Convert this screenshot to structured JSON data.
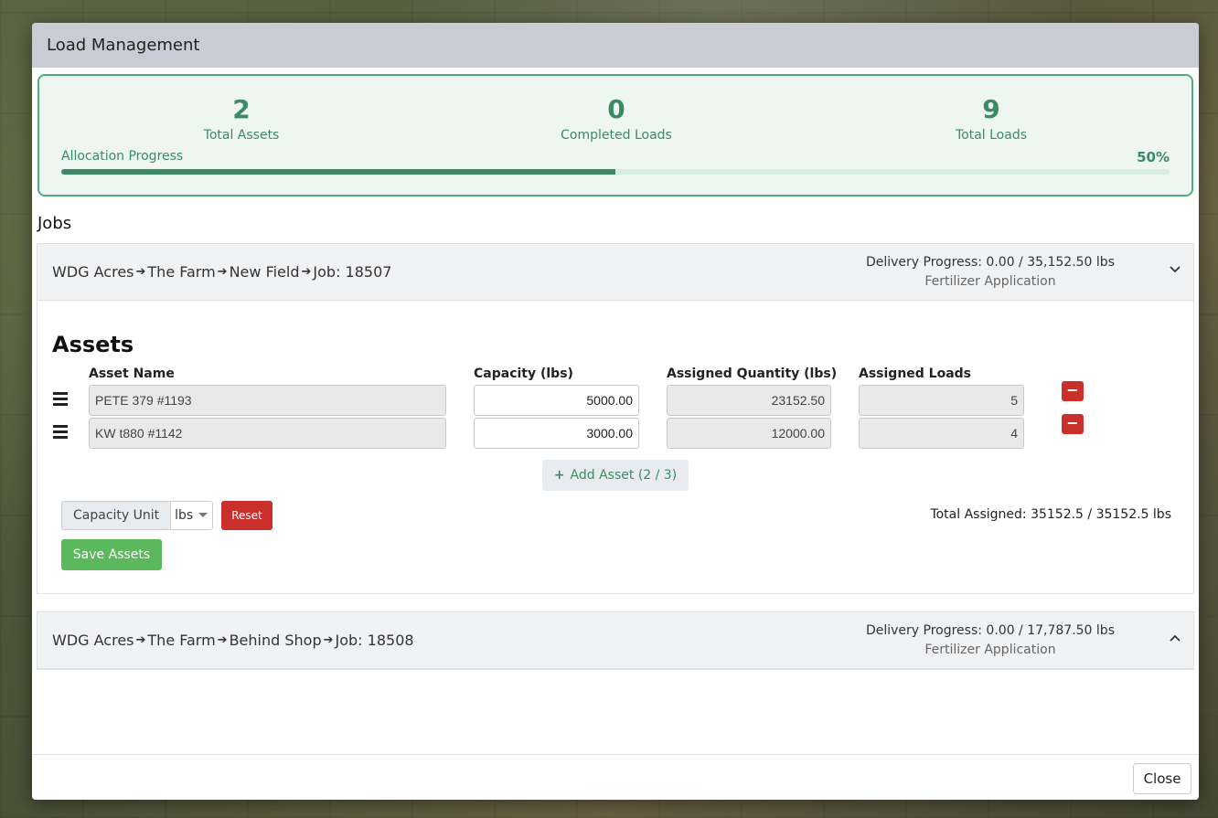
{
  "modal": {
    "title": "Load Management"
  },
  "stats": {
    "total_assets": {
      "value": "2",
      "label": "Total Assets"
    },
    "completed_loads": {
      "value": "0",
      "label": "Completed Loads"
    },
    "total_loads": {
      "value": "9",
      "label": "Total Loads"
    },
    "allocation": {
      "label": "Allocation Progress",
      "percent_text": "50%",
      "progress": 0.5
    }
  },
  "jobs_title": "Jobs",
  "jobs": [
    {
      "crumbs": [
        "WDG Acres",
        "The Farm",
        "New Field",
        "Job: 18507"
      ],
      "delivery_progress": "Delivery Progress: 0.00 / 35,152.50 lbs",
      "type": "Fertilizer Application",
      "expanded": true,
      "chevron": "chevron-down-icon"
    },
    {
      "crumbs": [
        "WDG Acres",
        "The Farm",
        "Behind Shop",
        "Job: 18508"
      ],
      "delivery_progress": "Delivery Progress: 0.00 / 17,787.50 lbs",
      "type": "Fertilizer Application",
      "expanded": false,
      "chevron": "chevron-up-icon"
    }
  ],
  "assets": {
    "title": "Assets",
    "columns": {
      "name": "Asset Name",
      "capacity": "Capacity (lbs)",
      "assigned_quantity": "Assigned Quantity (lbs)",
      "assigned_loads": "Assigned Loads"
    },
    "rows": [
      {
        "name": "PETE 379 #1193",
        "capacity": "5000.00",
        "assigned_quantity": "23152.50",
        "assigned_loads": "5"
      },
      {
        "name": "KW t880 #1142",
        "capacity": "3000.00",
        "assigned_quantity": "12000.00",
        "assigned_loads": "4"
      }
    ],
    "remove_label": "−",
    "add_asset_label": "Add Asset (2 / 3)",
    "capacity_unit_label": "Capacity Unit",
    "capacity_unit_value": "lbs",
    "reset_label": "Reset",
    "total_assigned": "Total Assigned: 35152.5 / 35152.5 lbs",
    "save_label": "Save Assets"
  },
  "footer": {
    "close_label": "Close"
  },
  "colors": {
    "accent": "#3c8a65",
    "danger": "#c9302c",
    "success": "#5cb85c"
  }
}
